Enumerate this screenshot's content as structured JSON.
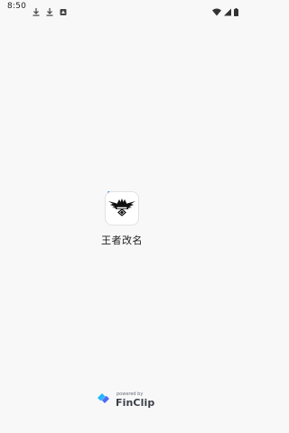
{
  "status_bar": {
    "time": "8:50",
    "left_icons": [
      "download-icon",
      "download-icon",
      "app-notification-icon"
    ],
    "right_icons": [
      "wifi-icon",
      "signal-icon",
      "battery-icon"
    ]
  },
  "splash": {
    "app_name": "王者改名",
    "logo_icon": "crowned-emblem-logo",
    "accent_dot_color": "#3b82f6"
  },
  "footer": {
    "powered_by": "powered by",
    "brand": "FinClip",
    "brand_colors": [
      "#1fb8ff",
      "#4a6cf7"
    ]
  }
}
